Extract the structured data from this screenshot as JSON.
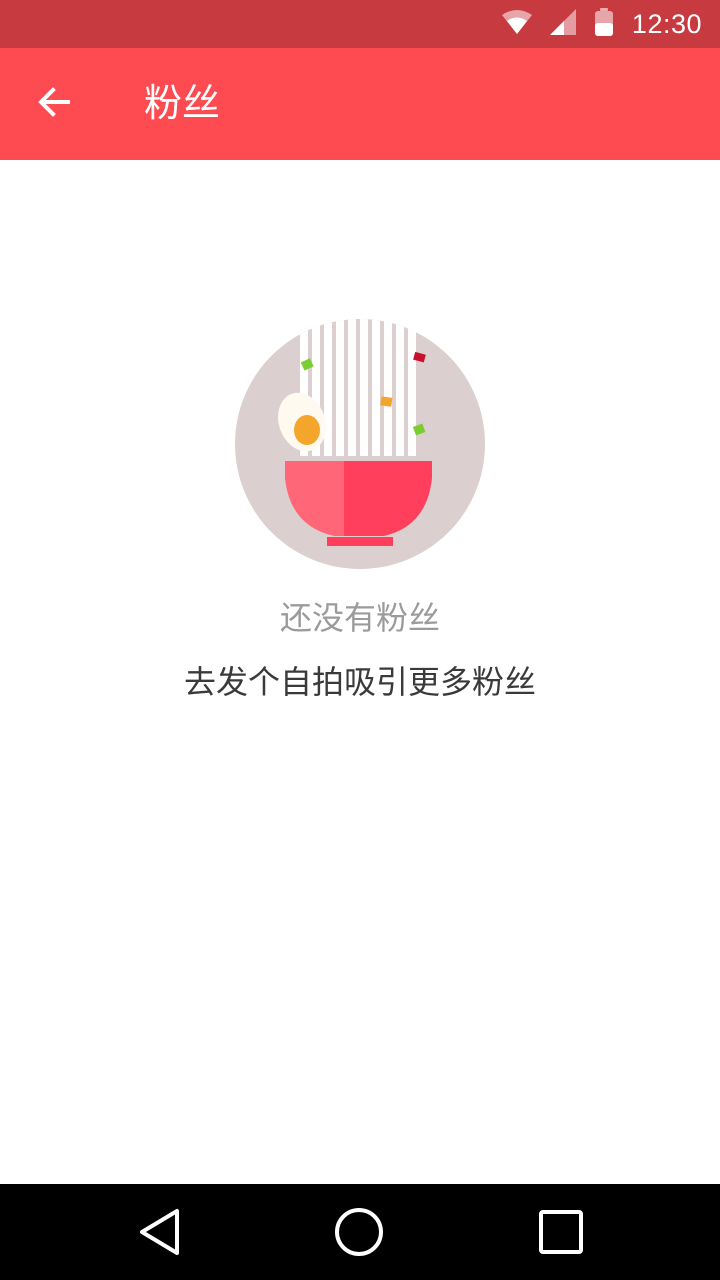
{
  "status_bar": {
    "time": "12:30",
    "icons": [
      "wifi-icon",
      "cell-signal-icon",
      "battery-icon"
    ],
    "background": "#c73b40"
  },
  "app_bar": {
    "title": "粉丝",
    "back_icon": "arrow-left-icon",
    "background": "#fe4b51"
  },
  "empty_state": {
    "illustration": "noodle-bowl-illustration",
    "title": "还没有粉丝",
    "subtitle": "去发个自拍吸引更多粉丝"
  },
  "nav_bar": {
    "buttons": [
      "back-triangle-icon",
      "home-circle-icon",
      "recents-square-icon"
    ],
    "background": "#000000"
  }
}
